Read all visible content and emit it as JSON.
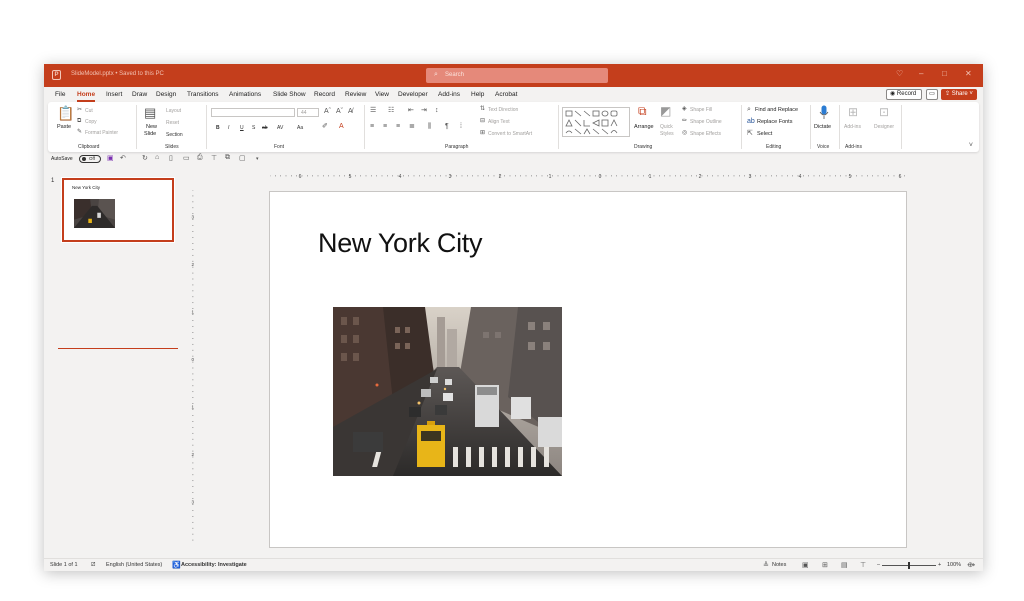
{
  "titlebar": {
    "filename": "SlideModel.pptx • Saved to this PC",
    "search_placeholder": "Search",
    "app_icon": "powerpoint-icon"
  },
  "menu": {
    "items": [
      "File",
      "Home",
      "Insert",
      "Draw",
      "Design",
      "Transitions",
      "Animations",
      "Slide Show",
      "Record",
      "Review",
      "View",
      "Developer",
      "Add-ins",
      "Help",
      "Acrobat"
    ],
    "active": "Home",
    "record_label": "Record",
    "share_label": "Share"
  },
  "ribbon": {
    "clipboard": {
      "label": "Clipboard",
      "paste": "Paste",
      "cut": "Cut",
      "copy": "Copy",
      "format_painter": "Format Painter"
    },
    "slides": {
      "label": "Slides",
      "new_slide": "New",
      "new_slide2": "Slide",
      "layout": "Layout",
      "reset": "Reset",
      "section": "Section"
    },
    "font": {
      "label": "Font",
      "size": "44",
      "bold": "B",
      "italic": "I",
      "underline": "U",
      "strike": "S",
      "abc": "ab",
      "av": "AV",
      "aa": "Aa"
    },
    "paragraph": {
      "label": "Paragraph",
      "text_direction": "Text Direction",
      "align_text": "Align Text",
      "convert_smartart": "Convert to SmartArt"
    },
    "drawing": {
      "label": "Drawing",
      "arrange": "Arrange",
      "quick_styles": "Quick",
      "quick_styles2": "Styles",
      "shape_fill": "Shape Fill",
      "shape_outline": "Shape Outline",
      "shape_effects": "Shape Effects"
    },
    "editing": {
      "label": "Editing",
      "find_replace": "Find and Replace",
      "replace_fonts": "Replace Fonts",
      "select": "Select"
    },
    "voice": {
      "label": "Voice",
      "dictate": "Dictate"
    },
    "addins": {
      "label": "Add-ins",
      "addins_btn": "Add-ins",
      "designer": "Designer"
    }
  },
  "qat": {
    "autosave": "AutoSave",
    "toggle": "Off"
  },
  "thumbnails": [
    {
      "number": "1",
      "title": "New York City"
    }
  ],
  "slide": {
    "title": "New York City"
  },
  "ruler": {
    "h_labels": [
      "6",
      "5",
      "4",
      "3",
      "2",
      "1",
      "0",
      "1",
      "2",
      "3",
      "4",
      "5",
      "6"
    ],
    "v_labels": [
      "3",
      "2",
      "1",
      "0",
      "1",
      "2",
      "3"
    ]
  },
  "status": {
    "slide_of": "Slide 1 of 1",
    "language": "English (United States)",
    "accessibility": "Accessibility: Investigate",
    "notes": "Notes",
    "zoom": "100%"
  },
  "colors": {
    "accent": "#c43e1c",
    "window_bg": "#f3f2f1",
    "ribbon_bg": "#ffffff"
  }
}
